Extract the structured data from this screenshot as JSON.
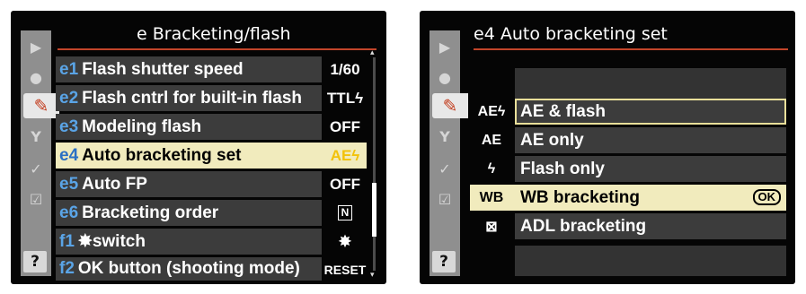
{
  "left_screen": {
    "menu_code": "e",
    "title": "Bracketing/flash",
    "items": [
      {
        "code": "e1",
        "label": "Flash shutter speed",
        "value": "1/60"
      },
      {
        "code": "e2",
        "label": "Flash cntrl for built-in flash",
        "value": "TTLϟ"
      },
      {
        "code": "e3",
        "label": "Modeling flash",
        "value": "OFF"
      },
      {
        "code": "e4",
        "label": "Auto bracketing set",
        "value": "AEϟ"
      },
      {
        "code": "e5",
        "label": "Auto FP",
        "value": "OFF"
      },
      {
        "code": "e6",
        "label": "Bracketing order",
        "value": "N"
      },
      {
        "code": "f1",
        "label": "✸switch",
        "value": "✸"
      },
      {
        "code": "f2",
        "label": "OK button (shooting mode)",
        "value": "RESET"
      }
    ],
    "selected_index": 3
  },
  "right_screen": {
    "menu_code": "e4",
    "title": "Auto bracketing set",
    "options": [
      {
        "abbr": "AEϟ",
        "label": "AE & flash"
      },
      {
        "abbr": "AE",
        "label": "AE only"
      },
      {
        "abbr": "ϟ",
        "label": "Flash only"
      },
      {
        "abbr": "WB",
        "label": "WB bracketing",
        "ok": "OK"
      },
      {
        "abbr": "⊠",
        "label": "ADL bracketing"
      }
    ],
    "outlined_index": 0,
    "selected_index": 3
  },
  "sidebar_icons": [
    {
      "name": "playback-menu-icon",
      "glyph": "▶"
    },
    {
      "name": "shooting-menu-icon",
      "glyph": "●"
    },
    {
      "name": "custom-settings-pencil-icon",
      "glyph": "✎"
    },
    {
      "name": "setup-wrench-icon",
      "glyph": "Y"
    },
    {
      "name": "retouch-icon",
      "glyph": "✓"
    },
    {
      "name": "my-menu-icon",
      "glyph": "☑"
    },
    {
      "name": "help-icon",
      "glyph": "?"
    }
  ],
  "colors": {
    "highlight": "#f1ebbd",
    "item_code": "#5aa4e6",
    "title_rule": "#c2452a",
    "row_bg": "#3c3c3c"
  }
}
